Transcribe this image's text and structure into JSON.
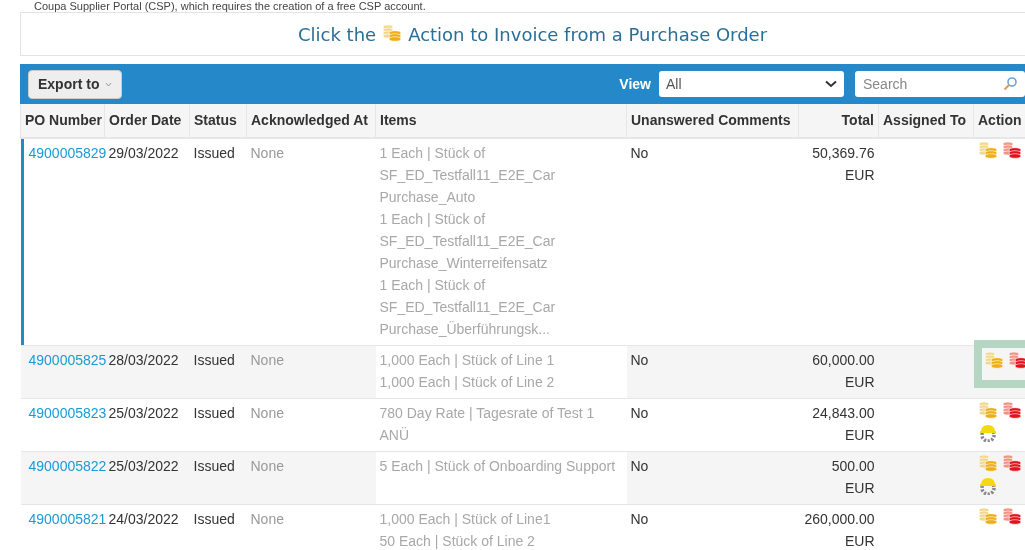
{
  "intro_text": "Coupa Supplier Portal (CSP), which requires the creation of a free CSP account.",
  "banner": {
    "before": "Click the",
    "after": "Action to Invoice from a Purchase Order"
  },
  "toolbar": {
    "export_button": "Export to",
    "view_label": "View",
    "view_value": "All",
    "search_placeholder": "Search"
  },
  "table": {
    "columns": [
      "PO Number",
      "Order Date",
      "Status",
      "Acknowledged At",
      "Items",
      "Unanswered Comments",
      "Total",
      "Assigned To",
      "Action"
    ],
    "rows": [
      {
        "selected": true,
        "highlighted": false,
        "po_number": "4900005829",
        "order_date": "29/03/2022",
        "status": "Issued",
        "acknowledged_at": "None",
        "items": [
          "1 Each | Stück of SF_ED_Testfall11_E2E_Car Purchase_Auto",
          "1 Each | Stück of SF_ED_Testfall11_E2E_Car Purchase_Winterreifensatz",
          "1 Each | Stück of SF_ED_Testfall11_E2E_Car Purchase_Überführungsk..."
        ],
        "unanswered_comments": "No",
        "total": "50,369.76 EUR",
        "actions": [
          {
            "kind": "invoice"
          },
          {
            "kind": "credit"
          }
        ]
      },
      {
        "selected": false,
        "highlighted": true,
        "po_number": "4900005825",
        "order_date": "28/03/2022",
        "status": "Issued",
        "acknowledged_at": "None",
        "items": [
          "1,000 Each | Stück of Line 1",
          "1,000 Each | Stück of Line 2"
        ],
        "unanswered_comments": "No",
        "total": "60,000.00 EUR",
        "actions": [
          {
            "kind": "invoice"
          },
          {
            "kind": "credit"
          }
        ]
      },
      {
        "selected": false,
        "highlighted": false,
        "po_number": "4900005823",
        "order_date": "25/03/2022",
        "status": "Issued",
        "acknowledged_at": "None",
        "items": [
          "780 Day Rate | Tagesrate of Test 1 ANÜ"
        ],
        "unanswered_comments": "No",
        "total": "24,843.00 EUR",
        "actions": [
          {
            "kind": "invoice"
          },
          {
            "kind": "credit"
          },
          {
            "kind": "worker"
          }
        ]
      },
      {
        "selected": false,
        "highlighted": false,
        "po_number": "4900005822",
        "order_date": "25/03/2022",
        "status": "Issued",
        "acknowledged_at": "None",
        "items": [
          "5 Each | Stück of Onboarding Support"
        ],
        "unanswered_comments": "No",
        "total": "500.00 EUR",
        "actions": [
          {
            "kind": "invoice"
          },
          {
            "kind": "credit"
          },
          {
            "kind": "worker"
          }
        ]
      },
      {
        "selected": false,
        "highlighted": false,
        "po_number": "4900005821",
        "order_date": "24/03/2022",
        "status": "Issued",
        "acknowledged_at": "None",
        "items": [
          "1,000 Each | Stück of Line1",
          "50 Each | Stück of Line 2"
        ],
        "unanswered_comments": "No",
        "total": "260,000.00 EUR",
        "actions": [
          {
            "kind": "invoice"
          },
          {
            "kind": "credit"
          }
        ]
      }
    ]
  }
}
